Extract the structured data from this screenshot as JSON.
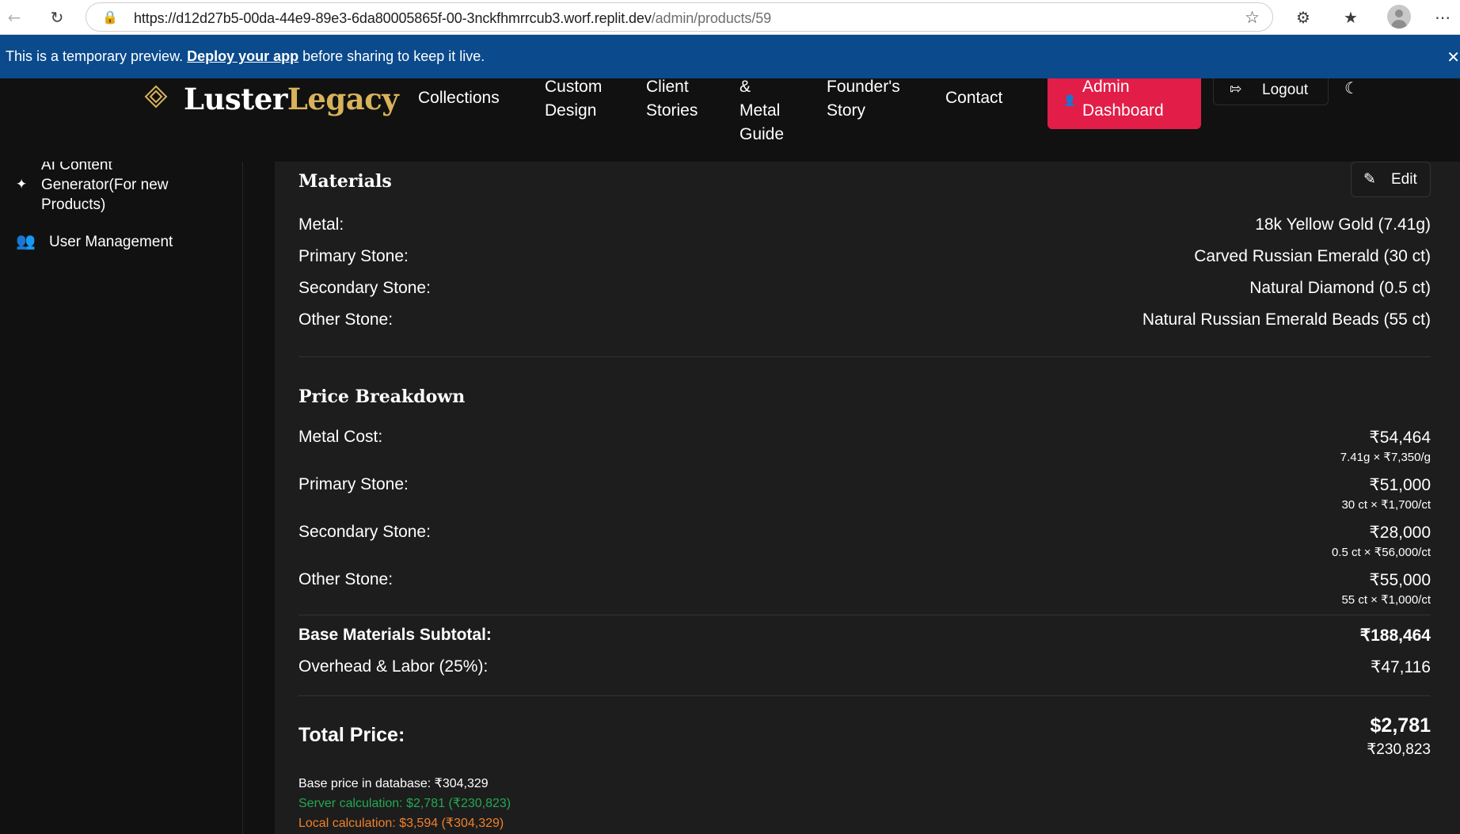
{
  "browser": {
    "url_host": "https://d12d27b5-00da-44e9-89e3-6da80005865f-00-3nckfhmrrcub3.worf.replit.dev",
    "url_path": "/admin/products/59"
  },
  "banner": {
    "prefix": "This is a temporary preview.",
    "link": "Deploy your app",
    "suffix": "before sharing to keep it live."
  },
  "header": {
    "logo_white": "Luster",
    "logo_gold": "Legacy",
    "nav": {
      "collections": "Collections",
      "custom_design_1": "Custom",
      "custom_design_2": "Design",
      "client_stories_1": "Client",
      "client_stories_2": "Stories",
      "guide_1": "&",
      "guide_2": "Metal",
      "guide_3": "Guide",
      "founders_1": "Founder's",
      "founders_2": "Story",
      "contact": "Contact"
    },
    "admin_1": "Admin",
    "admin_2": "Dashboard",
    "logout": "Logout"
  },
  "sidebar": {
    "ai_line1": "AI Content",
    "ai_line2": "Generator(For new",
    "ai_line3": "Products)",
    "users": "User Management"
  },
  "materials": {
    "title": "Materials",
    "edit": "Edit",
    "rows": [
      {
        "label": "Metal:",
        "value": "18k Yellow Gold (7.41g)"
      },
      {
        "label": "Primary Stone:",
        "value": "Carved Russian Emerald (30 ct)"
      },
      {
        "label": "Secondary Stone:",
        "value": "Natural Diamond (0.5 ct)"
      },
      {
        "label": "Other Stone:",
        "value": "Natural Russian Emerald Beads (55 ct)"
      }
    ]
  },
  "price": {
    "title": "Price Breakdown",
    "rows": [
      {
        "label": "Metal Cost:",
        "value": "₹54,464",
        "sub": "7.41g × ₹7,350/g"
      },
      {
        "label": "Primary Stone:",
        "value": "₹51,000",
        "sub": "30 ct × ₹1,700/ct"
      },
      {
        "label": "Secondary Stone:",
        "value": "₹28,000",
        "sub": "0.5 ct × ₹56,000/ct"
      },
      {
        "label": "Other Stone:",
        "value": "₹55,000",
        "sub": "55 ct × ₹1,000/ct"
      }
    ],
    "subtotal_label": "Base Materials Subtotal:",
    "subtotal_value": "₹188,464",
    "overhead_label": "Overhead & Labor (25%):",
    "overhead_value": "₹47,116",
    "total_label": "Total Price:",
    "total_usd": "$2,781",
    "total_inr": "₹230,823",
    "note_db": "Base price in database: ₹304,329",
    "note_server": "Server calculation: $2,781 (₹230,823)",
    "note_local": "Local calculation: $3,594 (₹304,329)"
  },
  "colors": {
    "banner": "#0b4a8c",
    "accent": "#e11d48",
    "gold": "#d8b25a",
    "server_green": "#22a94f",
    "local_orange": "#f0802a"
  },
  "icons": [
    "back-arrow-icon",
    "refresh-icon",
    "lock-icon",
    "star-icon",
    "extensions-icon",
    "favorites-icon",
    "profile-icon",
    "more-icon",
    "close-icon",
    "diamond-logo-icon",
    "user-icon",
    "logout-icon",
    "moon-icon",
    "magic-wand-icon",
    "users-icon",
    "pencil-icon"
  ]
}
